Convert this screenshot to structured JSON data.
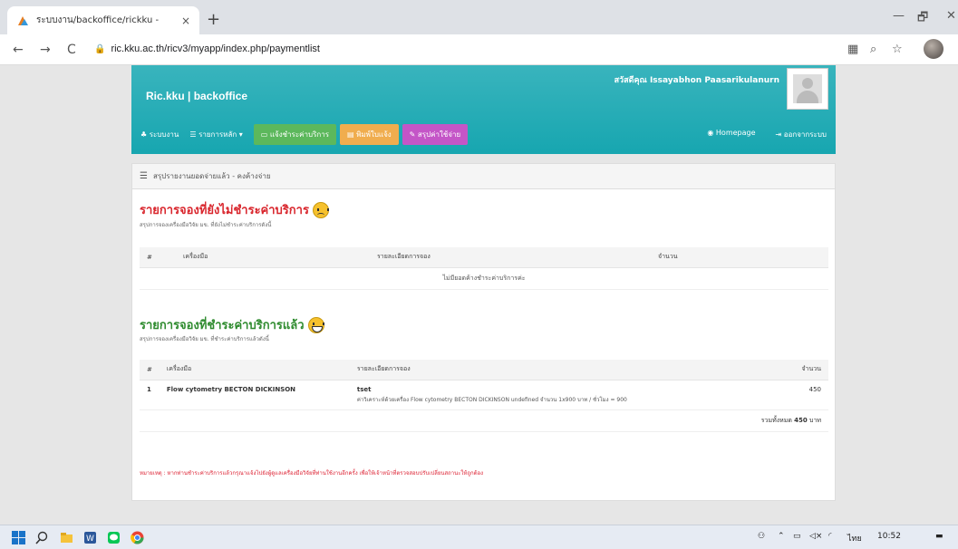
{
  "browser": {
    "tab_title": "ระบบงาน/backoffice/rickku -",
    "tab_close": "×",
    "new_tab": "+",
    "url": "ric.kku.ac.th/ricv3/myapp/index.php/paymentlist",
    "back": "←",
    "forward": "→",
    "reload": "C",
    "min": "—",
    "restore": "🗗",
    "close": "✕"
  },
  "header": {
    "brand": "Ric.kku | backoffice",
    "greeting": "สวัสดีคุณ Issayabhon Paasarikulanurn"
  },
  "nav": {
    "home": "ระบบงาน",
    "main_menu": "รายการหลัก",
    "btn_notify": "แจ้งชำระค่าบริการ",
    "btn_print": "พิมพ์ใบแจ้ง",
    "btn_summary": "สรุปค่าใช้จ่าย",
    "homepage": "Homepage",
    "logout": "ออกจากระบบ",
    "colors": {
      "notify": "#5cb85c",
      "print": "#f0ad4e",
      "summary": "#c455c7"
    }
  },
  "panel": {
    "heading": "สรุปรายงานยอดจ่ายแล้ว - คงค้างจ่าย"
  },
  "unpaid": {
    "title": "รายการจองที่ยังไม่ชำระค่าบริการ",
    "subtitle": "สรุปการจองเครื่องมือวิจัย มข. ที่ยังไม่ชำระค่าบริการดังนี้",
    "color": "#d9262d",
    "headers": [
      "#",
      "เครื่องมือ",
      "รายละเอียดการจอง",
      "จำนวน"
    ],
    "empty_text": "ไม่มียอดค้างชำระค่าบริการค่ะ"
  },
  "paid": {
    "title": "รายการจองที่ชำระค่าบริการแล้ว",
    "subtitle": "สรุปการจองเครื่องมือวิจัย มข. ที่ชำระค่าบริการแล้วดังนี้",
    "color": "#2e8b2e",
    "headers": [
      "#",
      "เครื่องมือ",
      "รายละเอียดการจอง",
      "จำนวน"
    ],
    "rows": [
      {
        "no": "1",
        "instrument": "Flow cytometry BECTON DICKINSON",
        "detail_title": "tset",
        "detail_sub": "ค่าวิเคราะห์ด้วยเครื่อง Flow cytometry BECTON DICKINSON undefined จำนวน 1x900 บาท / ชั่วโมง = 900",
        "amount": "450"
      }
    ],
    "total_label": "รวมทั้งหมด",
    "total_value": "450",
    "total_unit": "บาท"
  },
  "note": "หมายเหตุ : หากท่านชำระค่าบริการแล้วกรุณาแจ้งไปยังผู้ดูแลเครื่องมือวิจัยที่ท่านใช้งานอีกครั้ง เพื่อให้เจ้าหน้าที่ตรวจสอบปรับเปลี่ยนสถานะให้ถูกต้อง",
  "taskbar": {
    "lang": "ไทย",
    "time": "10:52"
  }
}
